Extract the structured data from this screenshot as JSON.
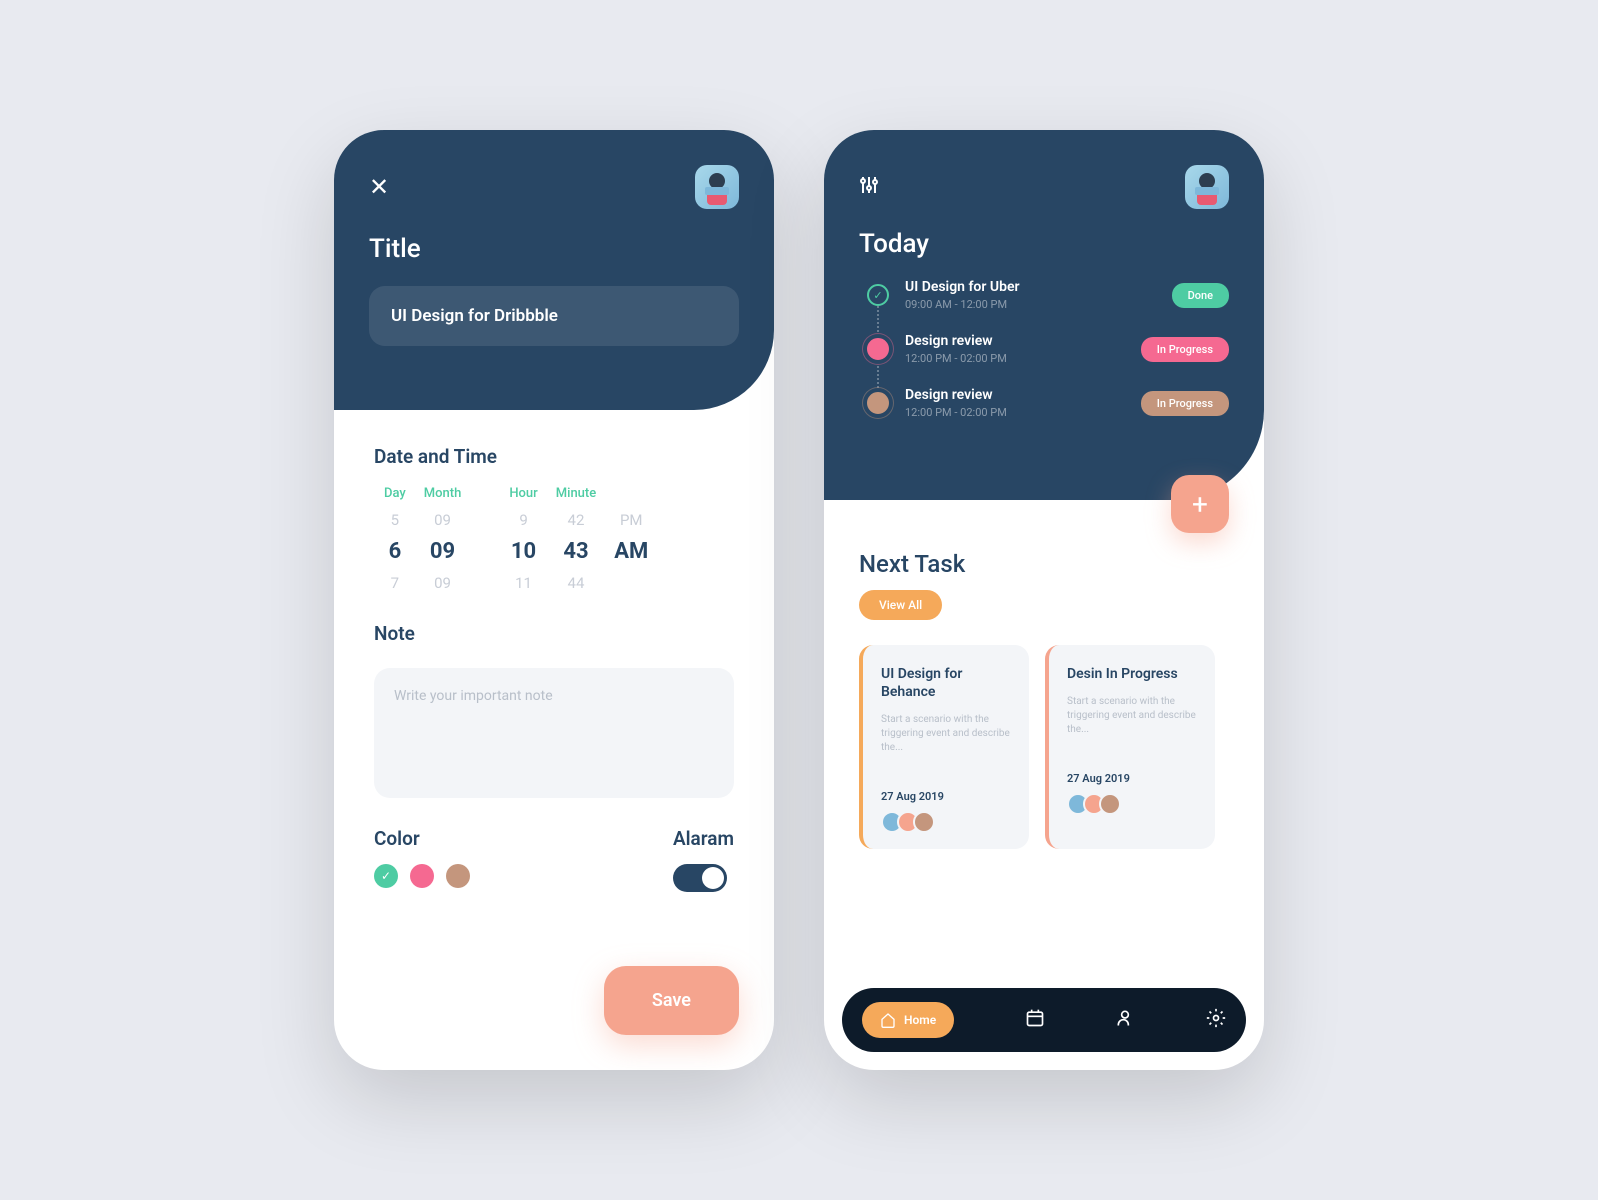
{
  "screen1": {
    "title_label": "Title",
    "title_value": "UI Design for Dribbble",
    "datetime_label": "Date and Time",
    "dt_headers": {
      "day": "Day",
      "month": "Month",
      "hour": "Hour",
      "minute": "Minute"
    },
    "day": {
      "prev": "5",
      "current": "6",
      "next": "7"
    },
    "month": {
      "prev": "09",
      "current": "09",
      "next": "09"
    },
    "hour": {
      "prev": "9",
      "current": "10",
      "next": "11"
    },
    "minute": {
      "prev": "42",
      "current": "43",
      "next": "44"
    },
    "meridiem": {
      "prev": "PM",
      "current": "AM"
    },
    "note_label": "Note",
    "note_placeholder": "Write your important note",
    "color_label": "Color",
    "alarm_label": "Alaram",
    "colors": [
      "#4ecca3",
      "#f56991",
      "#c4967d"
    ],
    "save_label": "Save"
  },
  "screen2": {
    "today_label": "Today",
    "tasks": [
      {
        "name": "UI Design for Uber",
        "time": "09:00 AM - 12:00 PM",
        "status": "Done"
      },
      {
        "name": "Design review",
        "time": "12:00 PM - 02:00 PM",
        "status": "In Progress"
      },
      {
        "name": "Design review",
        "time": "12:00 PM - 02:00 PM",
        "status": "In Progress"
      }
    ],
    "next_label": "Next Task",
    "view_all": "View All",
    "cards": [
      {
        "title": "UI Design\nfor Behance",
        "desc": "Start a scenario with the triggering event and describe the...",
        "date": "27 Aug 2019"
      },
      {
        "title": "Desin\nIn Progress",
        "desc": "Start a scenario with the triggering event and describe the...",
        "date": "27 Aug 2019"
      }
    ],
    "nav": {
      "home": "Home"
    }
  }
}
